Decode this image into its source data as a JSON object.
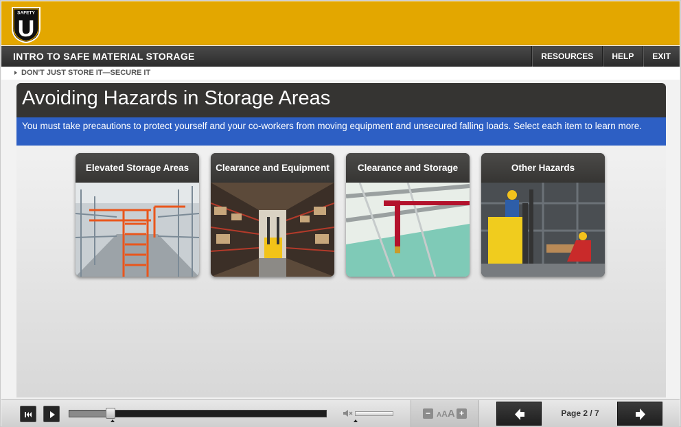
{
  "logo": {
    "text": "SAFETY",
    "letter": "U"
  },
  "header": {
    "course_title": "INTRO TO SAFE MATERIAL STORAGE",
    "nav": [
      "RESOURCES",
      "HELP",
      "EXIT"
    ]
  },
  "breadcrumb": "DON'T JUST STORE IT—SECURE IT",
  "main": {
    "title": "Avoiding Hazards in Storage Areas",
    "instruction": "You must take precautions to protect yourself and your co-workers from moving equipment and unsecured falling loads. Select each item to learn more.",
    "cards": [
      {
        "label": "Elevated Storage Areas"
      },
      {
        "label": "Clearance and Equipment"
      },
      {
        "label": "Clearance and Storage"
      },
      {
        "label": "Other Hazards"
      }
    ]
  },
  "player": {
    "text_size_label_small": "A",
    "text_size_label_mid": "A",
    "text_size_label_large": "A",
    "minus": "−",
    "plus": "+",
    "page_indicator": "Page 2 / 7",
    "progress_fraction": 0.16,
    "volume_fraction": 0.0
  },
  "colors": {
    "header_yellow": "#e3a700",
    "instruction_blue": "#2d5fc4",
    "title_dark": "#353432"
  }
}
